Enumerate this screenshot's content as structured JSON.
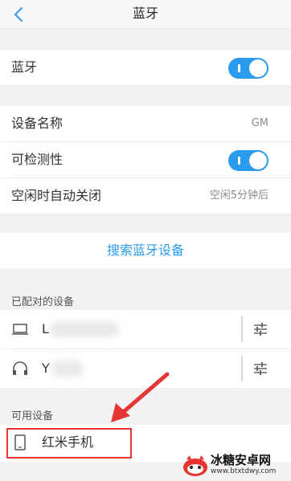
{
  "header": {
    "title": "蓝牙"
  },
  "bluetooth": {
    "label": "蓝牙",
    "enabled": true
  },
  "device_name": {
    "label": "设备名称",
    "value": "GM"
  },
  "discoverable": {
    "label": "可检测性",
    "enabled": true
  },
  "auto_close": {
    "label": "空闲时自动关闭",
    "value": "空闲5分钟后"
  },
  "search": {
    "label": "搜索蓝牙设备"
  },
  "paired": {
    "title": "已配对的设备",
    "devices": [
      {
        "name": "L",
        "icon": "laptop-icon"
      },
      {
        "name": "Y",
        "icon": "headphones-icon"
      }
    ]
  },
  "available": {
    "title": "可用设备",
    "devices": [
      {
        "name": "红米手机",
        "icon": "phone-icon"
      }
    ]
  },
  "colors": {
    "accent": "#2b9bf0",
    "highlight": "#e53535"
  },
  "watermark": {
    "title": "冰糖安卓网",
    "subtitle": "www.btxtdwy.com"
  }
}
